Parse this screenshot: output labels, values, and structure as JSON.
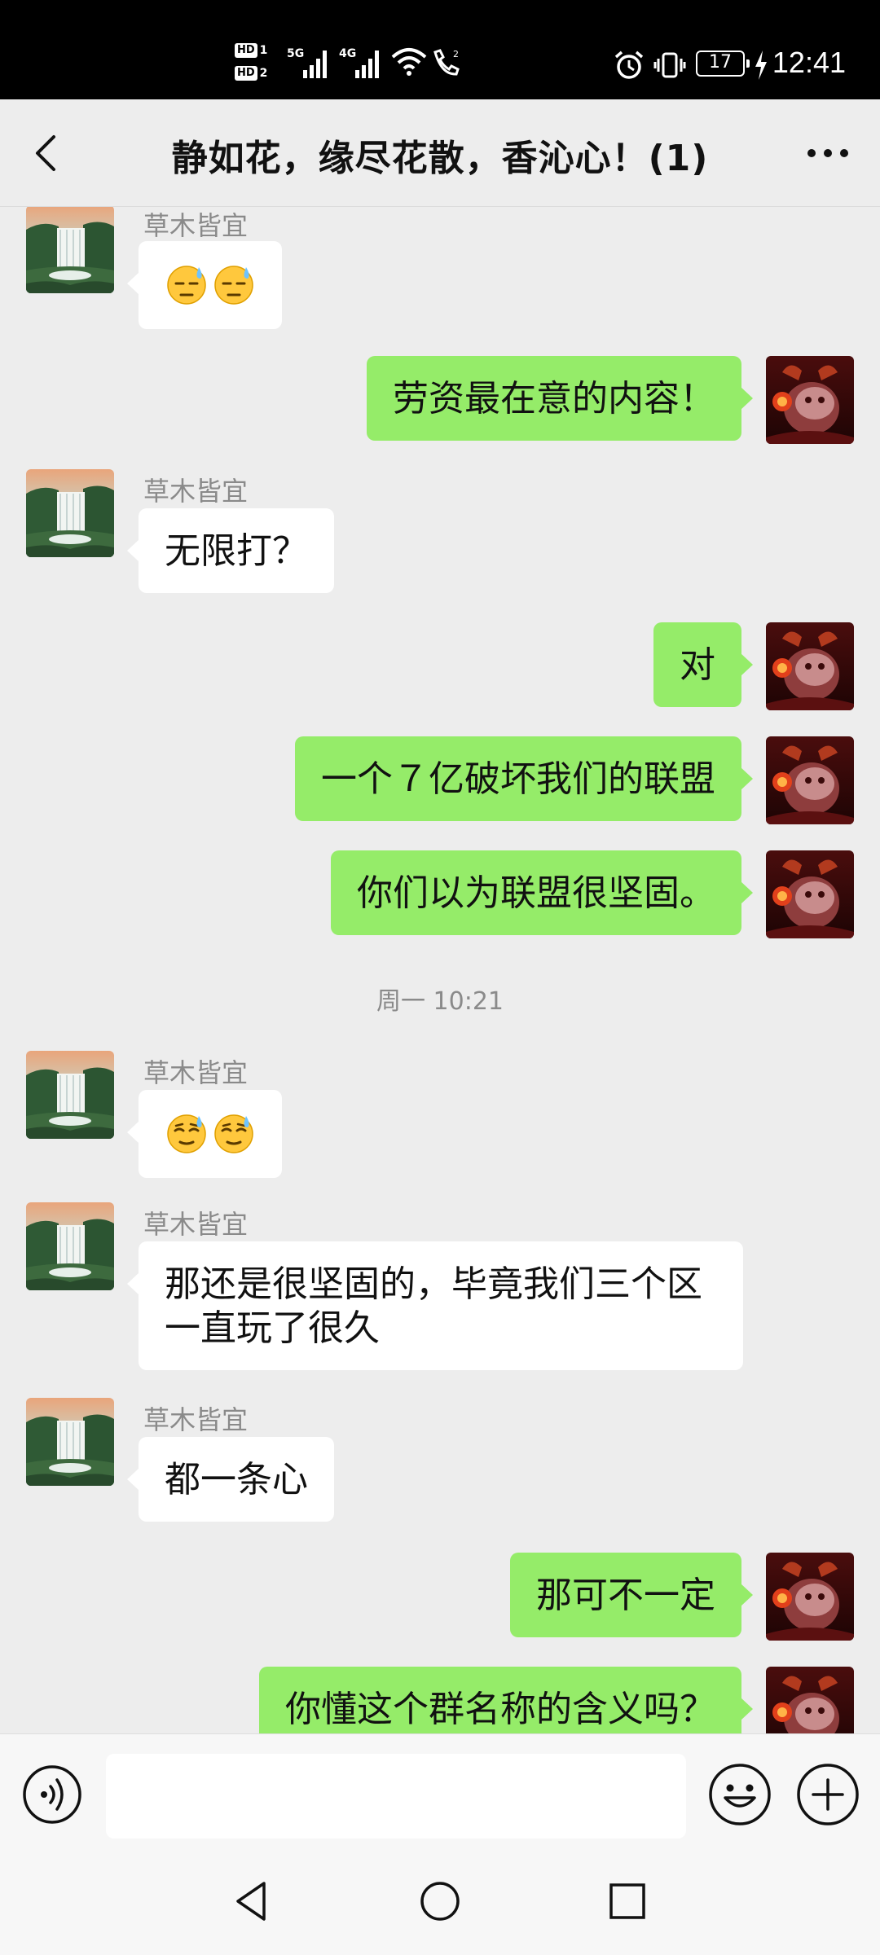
{
  "status_bar": {
    "time": "12:41",
    "battery": "17",
    "sim1_label": "HD",
    "sim1_num": "1",
    "sim2_label": "HD",
    "sim2_num": "2",
    "net1": "5G",
    "net2": "4G"
  },
  "header": {
    "title": "静如花，缘尽花散，香沁心！(1)",
    "back_icon": "chevron-left-icon",
    "more_icon": "more-horizontal-icon"
  },
  "messages": [
    {
      "from": "other",
      "sender": "草木皆宜",
      "emoji": [
        "sweat-expressionless",
        "sweat-expressionless"
      ]
    },
    {
      "from": "me",
      "text": "劳资最在意的内容！"
    },
    {
      "from": "other",
      "sender": "草木皆宜",
      "text": "无限打？"
    },
    {
      "from": "me",
      "text": "对"
    },
    {
      "from": "me",
      "text": "一个７亿破坏我们的联盟"
    },
    {
      "from": "me",
      "text": "你们以为联盟很坚固。"
    },
    {
      "timestamp": "周一 10:21"
    },
    {
      "from": "other",
      "sender": "草木皆宜",
      "emoji": [
        "relieved-sweat",
        "relieved-sweat"
      ]
    },
    {
      "from": "other",
      "sender": "草木皆宜",
      "text_line1": "那还是很坚固的，毕竟我们三个区",
      "text_line2": "一直玩了很久"
    },
    {
      "from": "other",
      "sender": "草木皆宜",
      "text": "都一条心"
    },
    {
      "from": "me",
      "text": "那可不一定"
    },
    {
      "from": "me",
      "text": "你懂这个群名称的含义吗？"
    }
  ],
  "input_bar": {
    "value": "",
    "voice_icon": "voice-icon",
    "emoji_icon": "emoji-icon",
    "plus_icon": "plus-icon"
  },
  "nav_bar": {
    "back_icon": "nav-back-icon",
    "home_icon": "nav-home-icon",
    "recent_icon": "nav-recent-icon"
  },
  "colors": {
    "chat_bg": "#ededed",
    "outgoing_bubble": "#95ec69",
    "incoming_bubble": "#ffffff"
  }
}
